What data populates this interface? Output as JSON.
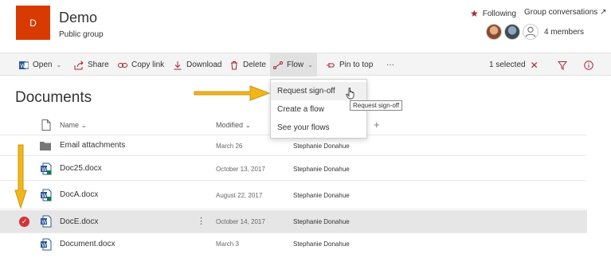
{
  "site": {
    "logo_letter": "D",
    "title": "Demo",
    "subtitle": "Public group"
  },
  "header_right": {
    "following_label": "Following",
    "conversations_label": "Group conversations",
    "members_label": "4 members"
  },
  "cmdbar": {
    "open_label": "Open",
    "share_label": "Share",
    "copy_link_label": "Copy link",
    "download_label": "Download",
    "delete_label": "Delete",
    "flow_label": "Flow",
    "pin_label": "Pin to top",
    "more_label": "···",
    "selected_label": "1 selected"
  },
  "library": {
    "title": "Documents",
    "columns": {
      "name": "Name",
      "modified": "Modified",
      "add": "+"
    },
    "rows": [
      {
        "name": "Email attachments",
        "modified": "March 26",
        "by": "Stephanie Donahue",
        "type": "folder",
        "selected": false
      },
      {
        "name": "Doc25.docx",
        "modified": "October 13, 2017",
        "by": "Stephanie Donahue",
        "type": "doc-green",
        "selected": false
      },
      {
        "name": "DocA.docx",
        "modified": "August 22, 2017",
        "by": "Stephanie Donahue",
        "type": "doc-green",
        "selected": false
      },
      {
        "name": "DocE.docx",
        "modified": "October 14, 2017",
        "by": "Stephanie Donahue",
        "type": "doc",
        "selected": true
      },
      {
        "name": "Document.docx",
        "modified": "March 3",
        "by": "Stephanie Donahue",
        "type": "doc",
        "selected": false
      }
    ]
  },
  "flow_menu": {
    "items": [
      "Request sign-off",
      "Create a flow",
      "See your flows"
    ],
    "tooltip": "Request sign-off"
  },
  "colors": {
    "brand": "#d83b01",
    "accent": "#a4262c",
    "arrow": "#f2b619",
    "check": "#d13438"
  }
}
